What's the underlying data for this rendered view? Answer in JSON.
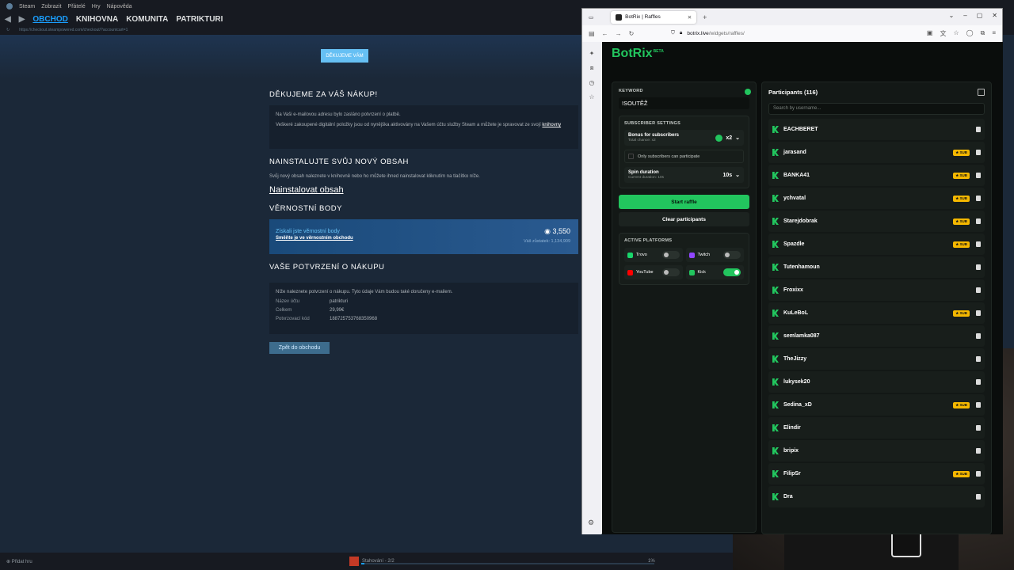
{
  "steam": {
    "menu": [
      "Steam",
      "Zobrazit",
      "Přátelé",
      "Hry",
      "Nápověda"
    ],
    "nav": {
      "obchod": "OBCHOD",
      "knihovna": "KNIHOVNA",
      "komunita": "KOMUNITA",
      "user": "PATRIKTURI"
    },
    "url": "https://checkout.steampowered.com/checkout/?accountcart=1",
    "thanks_tag": "DĚKUJEME VÁM",
    "h_thanks": "DĚKUJEME ZA VÁŠ NÁKUP!",
    "p_email": "Na Vaši e-mailovou adresu bylo zasláno potvrzení o platbě.",
    "p_items": "Veškeré zakoupené digitální položky jsou od nynějška aktivovány na Vašem účtu služby Steam a můžete je spravovat ze svojí",
    "p_library": "knihovny",
    "h_install": "NAINSTALUJTE SVŮJ NOVÝ OBSAH",
    "p_install": "Svůj nový obsah naleznete v knihovně nebo ho můžete ihned nainstalovat kliknutím na tlačítko níže.",
    "install_link": "Nainstalovat obsah",
    "h_loyalty": "VĚRNOSTNÍ BODY",
    "loyalty_earned": "Získali jste věrnostní body",
    "loyalty_spend": "Směňte je ve věrnostním obchodu",
    "loyalty_points": "3,550",
    "loyalty_balance": "Váš zůstatek: 1,134,909",
    "h_receipt": "VAŠE POTVRZENÍ O NÁKUPU",
    "p_receipt": "Níže naleznete potvrzení o nákupu. Tyto údaje Vám budou také doručeny e-mailem.",
    "receipt": [
      {
        "k": "Název účtu",
        "v": "patrikturi"
      },
      {
        "k": "Celkem",
        "v": "29,99€"
      },
      {
        "k": "Potvrzovací kód",
        "v": "1887257537683509​68"
      }
    ],
    "back_btn": "Zpět do obchodu",
    "status_add": "Přidat hru",
    "status_dl": "Stahování - 2/2",
    "status_pct": "1%",
    "download_progress": 0.01
  },
  "browser": {
    "tab_title": "BotRix | Raffles",
    "url_host": "botrix.live",
    "url_path": "/widgets/raffles/"
  },
  "botrix": {
    "brand": "BotRix",
    "beta": "BETA",
    "keyword_label": "KEYWORD",
    "keyword_value": "!SOUTĚŽ",
    "sub_settings_label": "SUBSCRIBER SETTINGS",
    "bonus_title": "Bonus for subscribers",
    "bonus_sub": "Total chance: x2",
    "bonus_value": "x2",
    "only_subs": "Only subscribers can participate",
    "spin_title": "Spin duration",
    "spin_sub": "Current duration: 10s",
    "spin_value": "10s",
    "start_btn": "Start raffle",
    "clear_btn": "Clear participants",
    "platforms_label": "ACTIVE PLATFORMS",
    "platforms": [
      {
        "name": "Trovo",
        "on": false,
        "color": "#19d66b"
      },
      {
        "name": "Twitch",
        "on": false,
        "color": "#9146ff"
      },
      {
        "name": "YouTube",
        "on": false,
        "color": "#ff0000"
      },
      {
        "name": "Kick",
        "on": true,
        "color": "#22c55e"
      }
    ],
    "participants_title": "Participants (116)",
    "search_placeholder": "Search by username...",
    "sub_badge": "★ SUB",
    "participants": [
      {
        "name": "EACHBERET",
        "sub": false
      },
      {
        "name": "jarasand",
        "sub": true
      },
      {
        "name": "BANKA41",
        "sub": true
      },
      {
        "name": "ychvatal",
        "sub": true
      },
      {
        "name": "Starejdobrak",
        "sub": true
      },
      {
        "name": "Spazdle",
        "sub": true
      },
      {
        "name": "Tutenhamoun",
        "sub": false
      },
      {
        "name": "Froxixx",
        "sub": false
      },
      {
        "name": "KuLeBoL",
        "sub": true
      },
      {
        "name": "semlamka087",
        "sub": false
      },
      {
        "name": "TheJizzy",
        "sub": false
      },
      {
        "name": "lukysek20",
        "sub": false
      },
      {
        "name": "Sedina_xD",
        "sub": true
      },
      {
        "name": "Elindir",
        "sub": false
      },
      {
        "name": "bripix",
        "sub": false
      },
      {
        "name": "FilipSr",
        "sub": true
      },
      {
        "name": "Dra",
        "sub": false
      }
    ]
  },
  "colors": {
    "accent": "#22c55e",
    "steam_blue": "#1a9fff",
    "sub_gold": "#f5b800"
  }
}
